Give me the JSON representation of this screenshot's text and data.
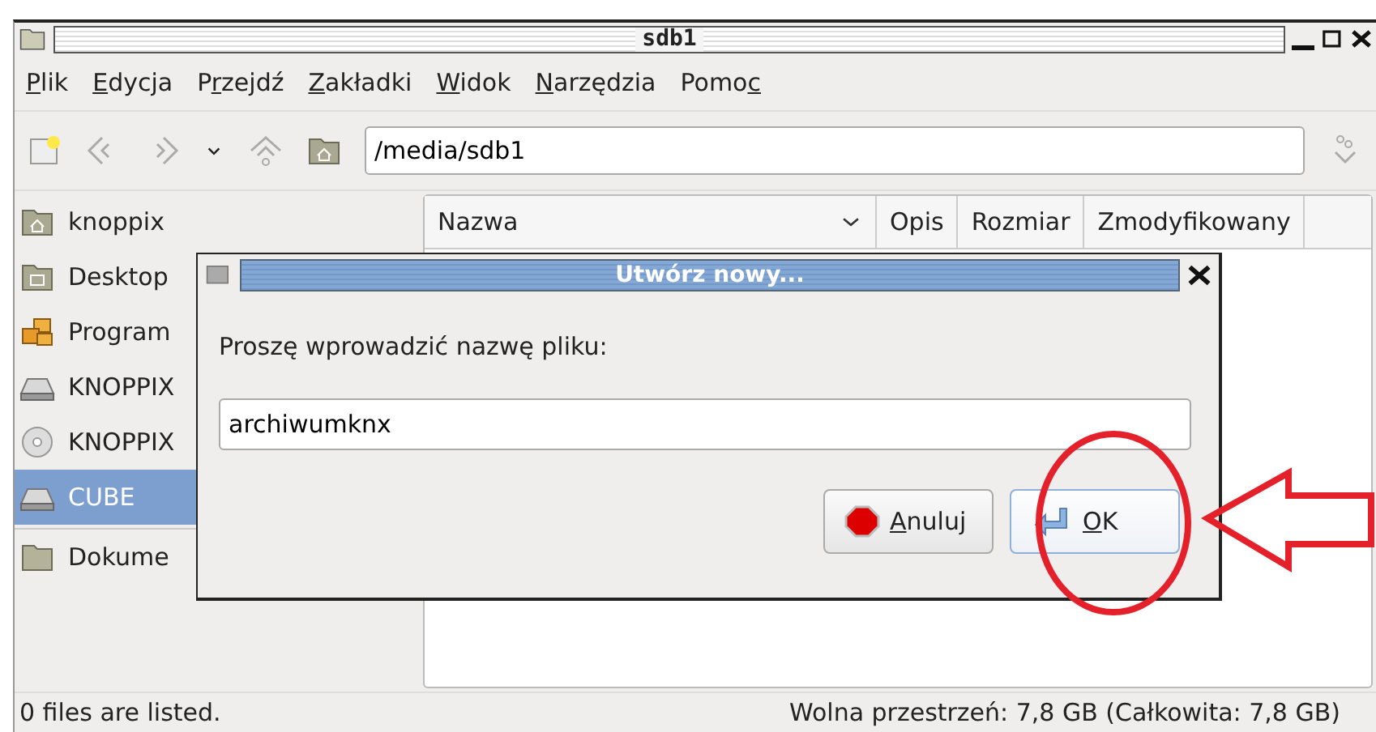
{
  "window": {
    "title": "sdb1"
  },
  "menu": [
    {
      "key": "P",
      "post": "lik"
    },
    {
      "key": "E",
      "post": "dycja"
    },
    {
      "pre": "P",
      "key": "r",
      "post": "zejdź"
    },
    {
      "key": "Z",
      "post": "akładki"
    },
    {
      "key": "W",
      "post": "idok"
    },
    {
      "key": "N",
      "post": "arzędzia"
    },
    {
      "pre": "Pomo",
      "key": "c"
    }
  ],
  "location": {
    "value": "/media/sdb1"
  },
  "sidebar": {
    "items": [
      {
        "label": "knoppix",
        "kind": "home",
        "selected": false
      },
      {
        "label": "Desktop",
        "kind": "desktop",
        "selected": false
      },
      {
        "label": "Program",
        "kind": "apps",
        "selected": false
      },
      {
        "label": "KNOPPIX",
        "kind": "drive",
        "selected": false
      },
      {
        "label": "KNOPPIX",
        "kind": "cdrom",
        "selected": false
      },
      {
        "label": "CUBE",
        "kind": "drive",
        "selected": true
      },
      {
        "label": "Dokume",
        "kind": "folder",
        "selected": false,
        "separator_before": true
      }
    ]
  },
  "table": {
    "columns": [
      "Nazwa",
      "Opis",
      "Rozmiar",
      "Zmodyfikowany"
    ]
  },
  "dialog": {
    "title": "Utwórz nowy...",
    "prompt": "Proszę wprowadzić nazwę pliku:",
    "value": "archiwumknx",
    "buttons": [
      {
        "key": "A",
        "post": "nuluj",
        "kind": "cancel",
        "focused": false
      },
      {
        "key": "O",
        "post": "K",
        "kind": "ok",
        "focused": true
      }
    ]
  },
  "status_bar": {
    "left": "0 files are listed.",
    "right": "Wolna przestrzeń: 7,8 GB (Całkowita: 7,8 GB)"
  }
}
